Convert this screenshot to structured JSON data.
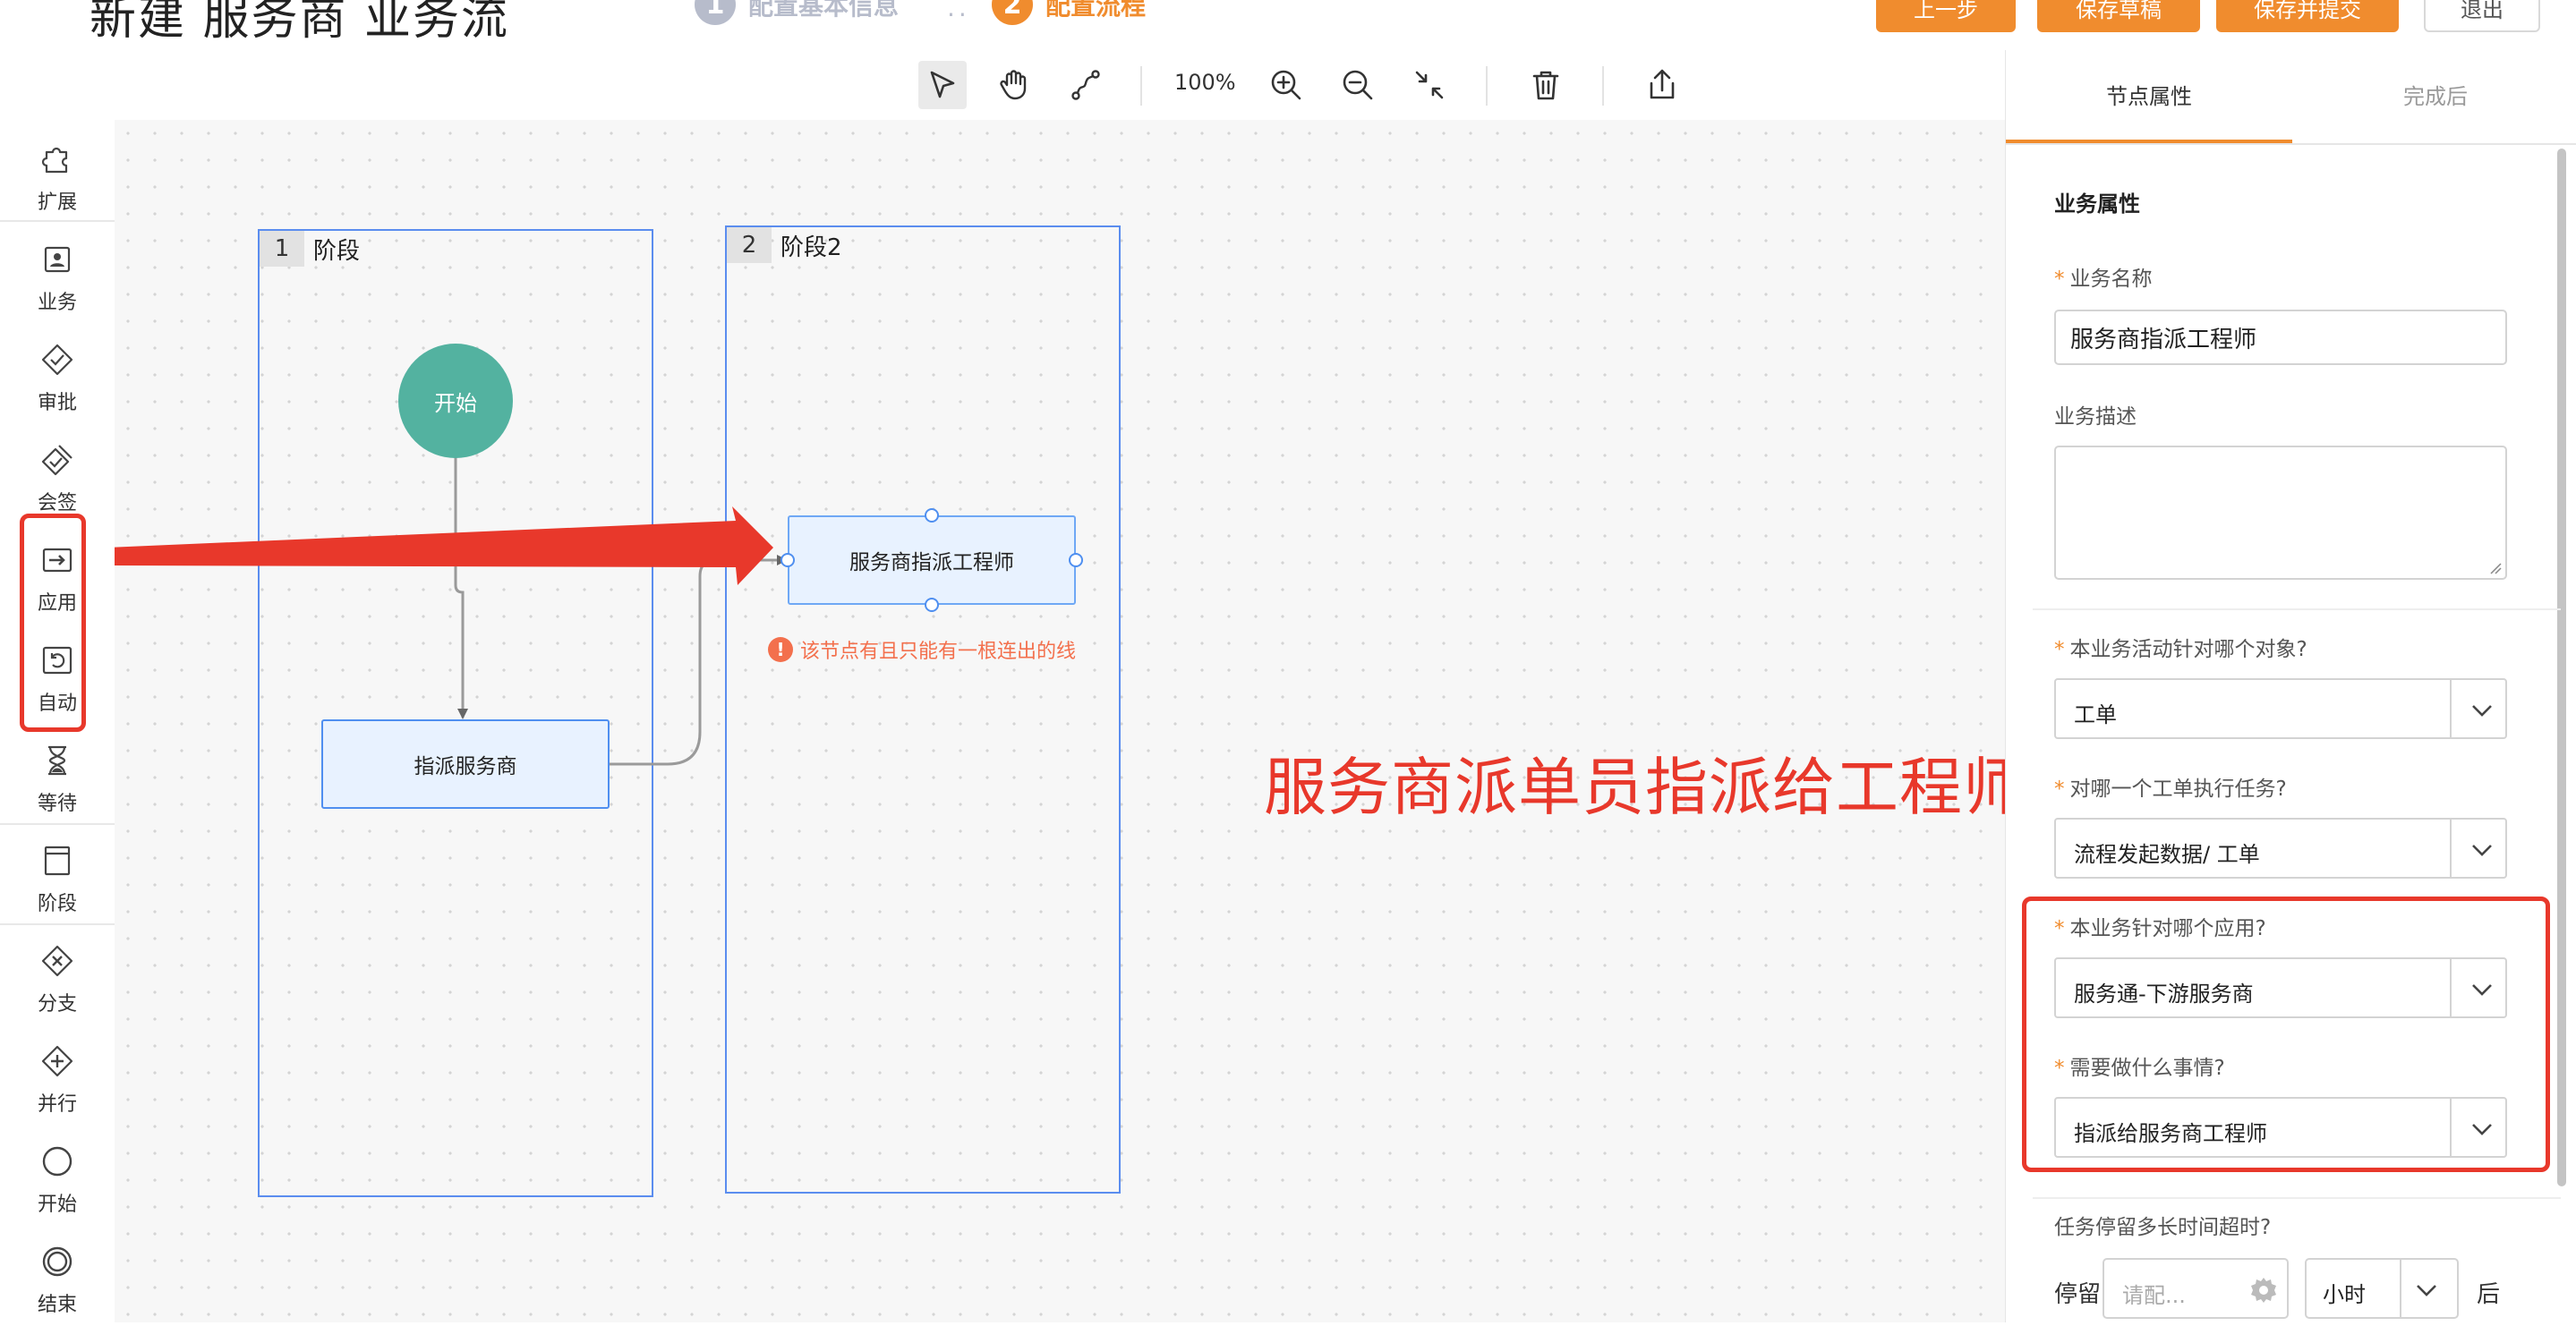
{
  "header": {
    "title": "新建 服务商 业务流",
    "steps": [
      {
        "num": "1",
        "label": "配置基本信息"
      },
      {
        "num": "2",
        "label": "配置流程"
      }
    ],
    "step_separator": "..",
    "buttons": {
      "prev": "上一步",
      "save_draft": "保存草稿",
      "save_submit": "保存并提交",
      "exit": "退出"
    }
  },
  "toolbar": {
    "zoom": "100%",
    "icons": [
      "select-icon",
      "hand-icon",
      "connector-icon",
      "zoom-in-icon",
      "zoom-out-icon",
      "fit-icon",
      "delete-icon",
      "export-icon"
    ]
  },
  "palette": {
    "items": [
      {
        "label": "扩展",
        "icon": "puzzle-icon"
      },
      {
        "label": "业务",
        "icon": "business-icon"
      },
      {
        "label": "审批",
        "icon": "approve-icon"
      },
      {
        "label": "会签",
        "icon": "countersign-icon"
      },
      {
        "label": "应用",
        "icon": "app-icon"
      },
      {
        "label": "自动",
        "icon": "auto-icon"
      },
      {
        "label": "等待",
        "icon": "hourglass-icon"
      },
      {
        "label": "阶段",
        "icon": "stage-icon"
      },
      {
        "label": "分支",
        "icon": "branch-icon"
      },
      {
        "label": "并行",
        "icon": "parallel-icon"
      },
      {
        "label": "开始",
        "icon": "start-icon"
      },
      {
        "label": "结束",
        "icon": "end-icon"
      }
    ]
  },
  "canvas": {
    "stages": [
      {
        "num": "1",
        "name": "阶段"
      },
      {
        "num": "2",
        "name": "阶段2"
      }
    ],
    "nodes": {
      "start": "开始",
      "assign_provider": "指派服务商",
      "assign_engineer": "服务商指派工程师"
    },
    "warning": "该节点有且只能有一根连出的线",
    "annotation": "服务商派单员指派给工程师"
  },
  "panel": {
    "tabs": [
      "节点属性",
      "完成后"
    ],
    "section_title": "业务属性",
    "fields": {
      "name_label": "业务名称",
      "name_value": "服务商指派工程师",
      "desc_label": "业务描述",
      "object_label": "本业务活动针对哪个对象?",
      "object_value": "工单",
      "ticket_label": "对哪一个工单执行任务?",
      "ticket_value": "流程发起数据/ 工单",
      "app_label": "本业务针对哪个应用?",
      "app_value": "服务通-下游服务商",
      "action_label": "需要做什么事情?",
      "action_value": "指派给服务商工程师",
      "timeout_label": "任务停留多长时间超时?",
      "stay_label": "停留",
      "stay_placeholder": "请配...",
      "unit_value": "小时",
      "after_label": "后"
    }
  },
  "colors": {
    "accent": "#f08c2e",
    "annotation_red": "#e8382b",
    "node_border": "#4f8ff0",
    "start_node": "#53b2a0",
    "warning": "#f3704d"
  }
}
